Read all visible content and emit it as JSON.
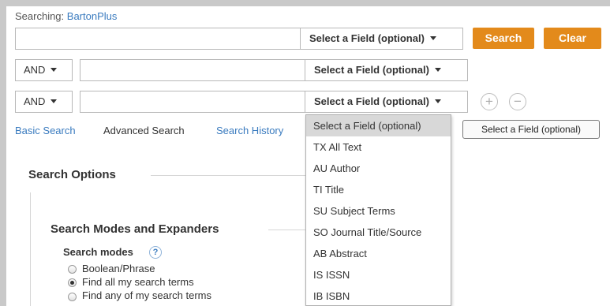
{
  "header": {
    "searching_label": "Searching:",
    "database": "BartonPlus"
  },
  "search_rows": [
    {
      "term": "",
      "field": "Select a Field (optional)"
    },
    {
      "operator": "AND",
      "term": "",
      "field": "Select a Field (optional)"
    },
    {
      "operator": "AND",
      "term": "",
      "field": "Select a Field (optional)"
    }
  ],
  "buttons": {
    "search": "Search",
    "clear": "Clear",
    "add_row": "+",
    "remove_row": "−"
  },
  "nav": {
    "basic": "Basic Search",
    "advanced": "Advanced Search",
    "history": "Search History"
  },
  "field_dropdown": {
    "options": [
      "Select a Field (optional)",
      "TX All Text",
      "AU Author",
      "TI Title",
      "SU Subject Terms",
      "SO Journal Title/Source",
      "AB Abstract",
      "IS ISSN",
      "IB ISBN"
    ],
    "selected": "Select a Field (optional)"
  },
  "tooltip": "Select a Field (optional)",
  "options": {
    "title": "Search Options",
    "modes_section": "Search Modes and Expanders",
    "modes_label": "Search modes",
    "help": "?",
    "modes": [
      {
        "label": "Boolean/Phrase",
        "checked": false
      },
      {
        "label": "Find all my search terms",
        "checked": true
      },
      {
        "label": "Find any of my search terms",
        "checked": false
      }
    ]
  },
  "colors": {
    "accent": "#e38a1b",
    "link": "#3a7bbf"
  }
}
